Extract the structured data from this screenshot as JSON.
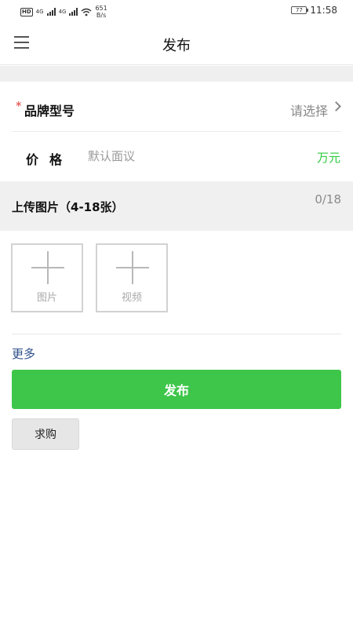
{
  "status_bar": {
    "hd": "HD",
    "sim1": "4G",
    "sim2": "4G",
    "net_speed_value": "651",
    "net_speed_unit": "B/s",
    "battery": "77",
    "time": "11:58"
  },
  "nav": {
    "title": "发布",
    "menu_icon": "hamburger-menu-icon"
  },
  "form": {
    "brand": {
      "required_mark": "*",
      "label": "品牌型号",
      "value": "请选择",
      "chevron_icon": "chevron-right-icon"
    },
    "price": {
      "label": "价格",
      "placeholder": "默认面议",
      "value": "",
      "unit": "万元"
    }
  },
  "upload": {
    "title": "上传图片（4-18张）",
    "count": "0/18",
    "tiles": [
      {
        "label": "图片",
        "icon": "plus-icon"
      },
      {
        "label": "视频",
        "icon": "plus-icon"
      }
    ]
  },
  "more_label": "更多",
  "actions": {
    "publish_label": "发布",
    "buy_label": "求购"
  },
  "colors": {
    "accent_green": "#3dc64a",
    "unit_green": "#2ecc40",
    "required_red": "#e53935",
    "link_blue": "#2d4f8a"
  }
}
